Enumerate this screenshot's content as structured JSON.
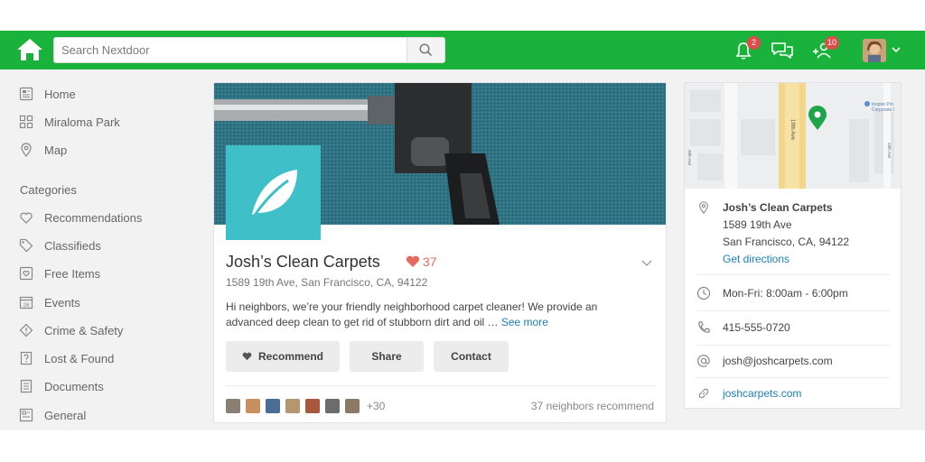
{
  "search": {
    "placeholder": "Search Nextdoor"
  },
  "header": {
    "notifications_badge": "2",
    "neighbors_badge": "10"
  },
  "sidebar": {
    "items": [
      {
        "label": "Home",
        "icon": "newspaper-icon"
      },
      {
        "label": "Miraloma Park",
        "icon": "neighborhood-icon"
      },
      {
        "label": "Map",
        "icon": "map-pin-icon"
      }
    ],
    "categories_heading": "Categories",
    "categories": [
      {
        "label": "Recommendations",
        "icon": "heart-icon"
      },
      {
        "label": "Classifieds",
        "icon": "tag-icon"
      },
      {
        "label": "Free Items",
        "icon": "gift-icon"
      },
      {
        "label": "Events",
        "icon": "calendar-icon",
        "icon_text": "26"
      },
      {
        "label": "Crime & Safety",
        "icon": "alert-icon"
      },
      {
        "label": "Lost & Found",
        "icon": "question-icon"
      },
      {
        "label": "Documents",
        "icon": "document-icon"
      },
      {
        "label": "General",
        "icon": "general-icon"
      }
    ]
  },
  "business": {
    "name": "Josh’s Clean Carpets",
    "likes": "37",
    "address": "1589 19th Ave, San Francisco, CA, 94122",
    "description": "Hi neighbors, we’re your friendly neighborhood carpet cleaner! We provide an advanced deep clean to get rid of stubborn dirt and oil … ",
    "see_more": "See more",
    "buttons": {
      "recommend": "Recommend",
      "share": "Share",
      "contact": "Contact"
    },
    "extra_recommenders": "+30",
    "recommend_count": "37 neighbors recommend"
  },
  "map": {
    "street_main": "19th Ave",
    "street_left": "20th Ave",
    "street_right": "18th Ave",
    "poi_label_1": "Inspire Pro",
    "poi_label_2": "Corporate I"
  },
  "details": {
    "name": "Josh’s Clean Carpets",
    "address_line1": "1589 19th Ave",
    "address_line2": "San Francisco, CA, 94122",
    "directions": "Get directions",
    "hours": "Mon-Fri: 8:00am - 6:00pm",
    "phone": "415-555-0720",
    "email": "josh@joshcarpets.com",
    "website": "joshcarpets.com"
  },
  "colors": {
    "brand_green": "#19b23a",
    "link_blue": "#1d7fb5",
    "heart_red": "#e56b62",
    "logo_teal": "#3fc0c8"
  }
}
